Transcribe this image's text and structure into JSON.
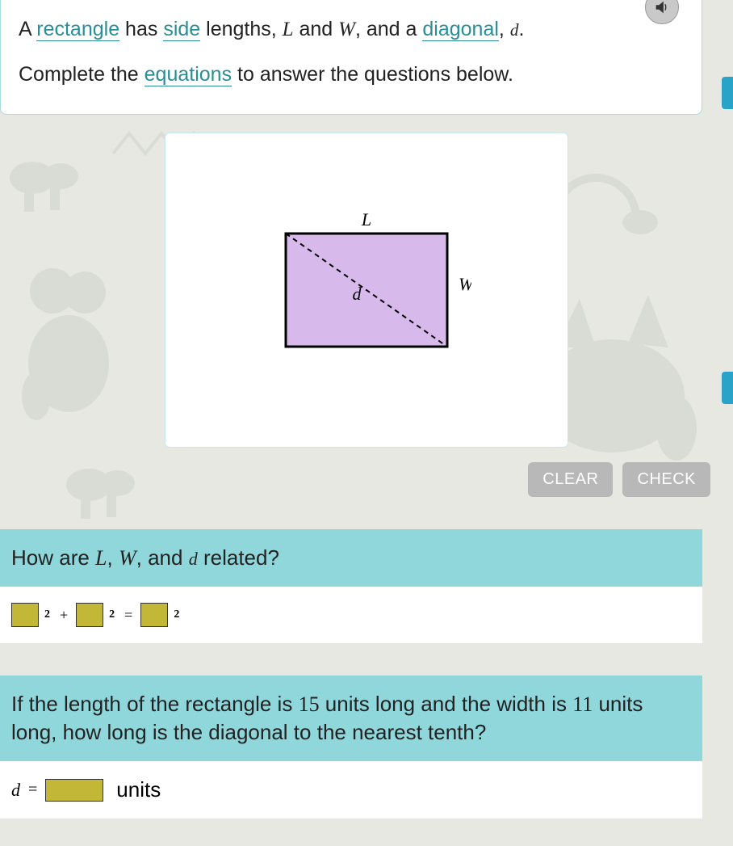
{
  "prompt": {
    "pre1": "A ",
    "vocab_rectangle": "rectangle",
    "mid1": " has ",
    "vocab_side": "side",
    "mid2": " lengths, ",
    "var_L": "L",
    "mid3": " and ",
    "var_W": "W",
    "mid4": ", and a ",
    "vocab_diagonal": "diagonal",
    "mid5": ", ",
    "var_d": "d",
    "mid6": ".",
    "line2a": "Complete the ",
    "vocab_equations": "equations",
    "line2b": " to answer the questions below."
  },
  "figure": {
    "label_L": "L",
    "label_W": "W",
    "label_d": "d"
  },
  "buttons": {
    "clear": "CLEAR",
    "check": "CHECK"
  },
  "q1": {
    "pre": "How are ",
    "L": "L",
    "sep1": ", ",
    "W": "W",
    "sep2": ", and ",
    "d": "d",
    "post": " related?",
    "exp": "2",
    "plus": "+",
    "eq": "="
  },
  "q2": {
    "t1": "If the length of the rectangle is ",
    "n1": "15",
    "t2": " units long and the width is ",
    "n2": "11",
    "t3": " units long, how long is the diagonal to the nearest tenth?",
    "dlabel": "d",
    "eq": "=",
    "units": "units"
  }
}
